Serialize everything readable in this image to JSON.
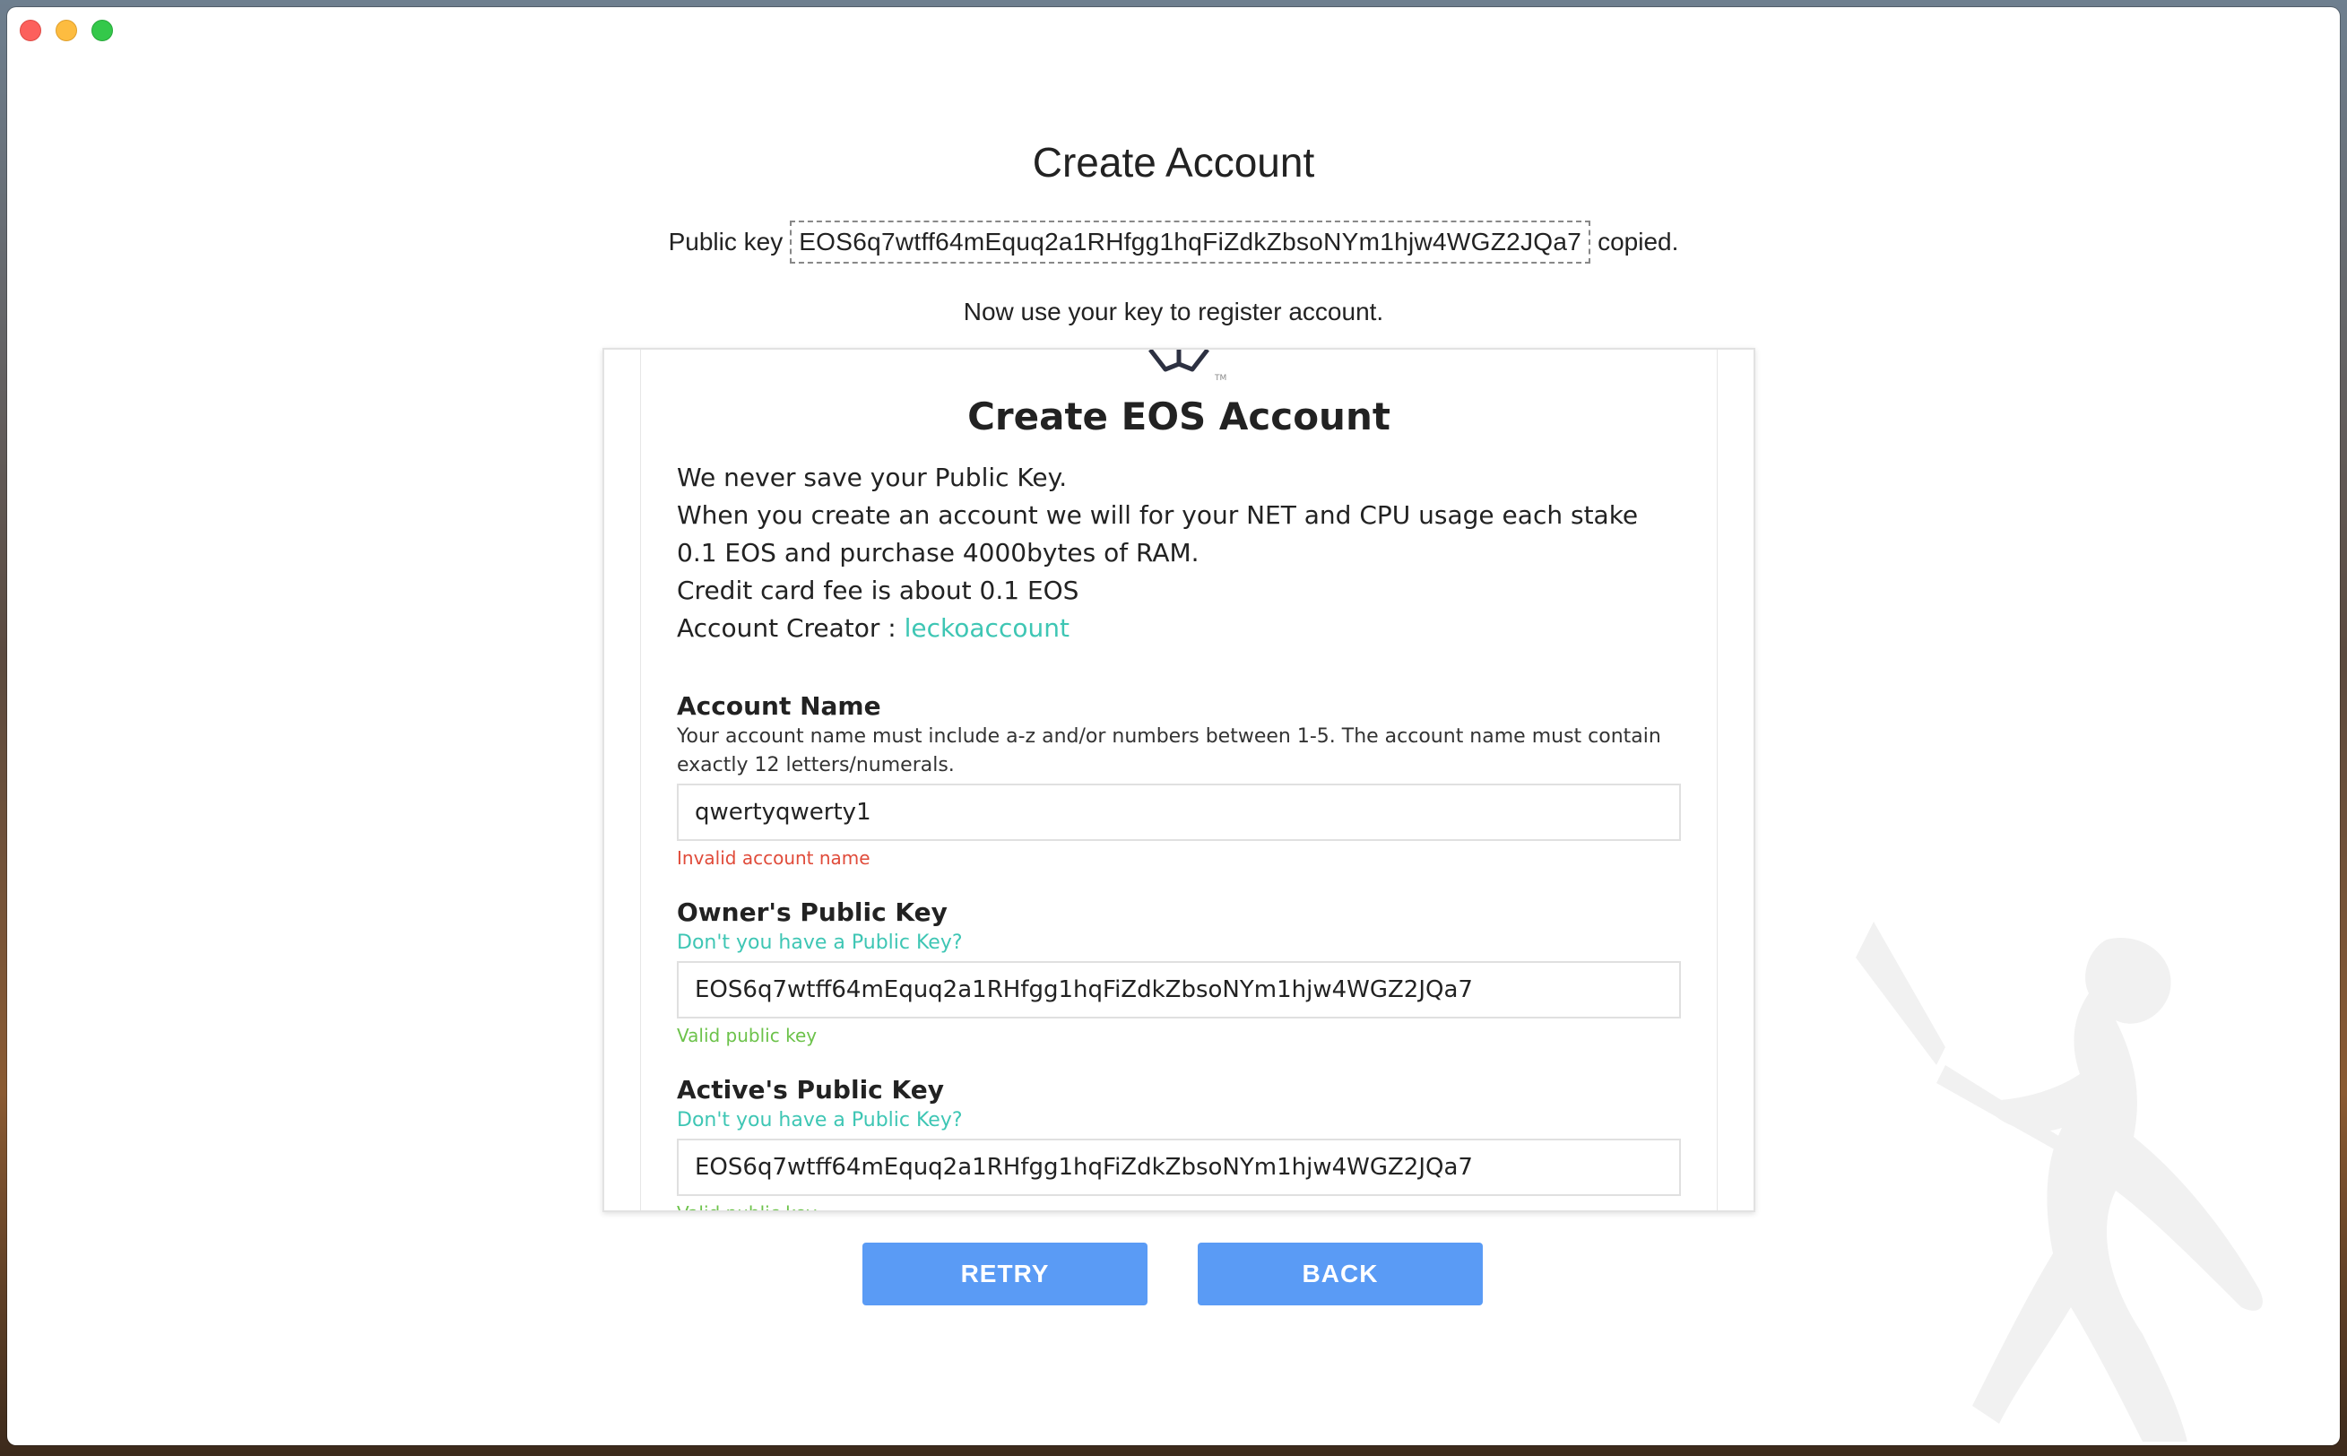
{
  "header": {
    "title": "Create Account",
    "public_key_label": "Public key",
    "public_key": "EOS6q7wtff64mEquq2a1RHfgg1hqFiZdkZbsoNYm1hjw4WGZ2JQa7",
    "copied_suffix": "copied.",
    "instruction": "Now use your key to register account."
  },
  "card": {
    "title": "Create EOS Account",
    "info_lines": [
      "We never save your Public Key.",
      "When you create an account we will for your NET and CPU usage each stake 0.1 EOS and purchase 4000bytes of RAM.",
      "Credit card fee is about 0.1 EOS"
    ],
    "creator_label": "Account Creator : ",
    "creator_name": "leckoaccount",
    "account_name": {
      "label": "Account Name",
      "help": "Your account name must include a-z and/or numbers between 1-5. The account name must contain exactly 12 letters/numerals.",
      "value": "qwertyqwerty1",
      "message": "Invalid account name"
    },
    "owner_key": {
      "label": "Owner's Public Key",
      "link": "Don't you have a Public Key?",
      "value": "EOS6q7wtff64mEquq2a1RHfgg1hqFiZdkZbsoNYm1hjw4WGZ2JQa7",
      "message": "Valid public key"
    },
    "active_key": {
      "label": "Active's Public Key",
      "link": "Don't you have a Public Key?",
      "value": "EOS6q7wtff64mEquq2a1RHfgg1hqFiZdkZbsoNYm1hjw4WGZ2JQa7",
      "message": "Valid public key"
    }
  },
  "buttons": {
    "retry": "RETRY",
    "back": "BACK"
  },
  "colors": {
    "accent_teal": "#3ec6b4",
    "button_blue": "#5a9bf5",
    "error_red": "#e04b3a",
    "valid_green": "#6cc24a"
  }
}
